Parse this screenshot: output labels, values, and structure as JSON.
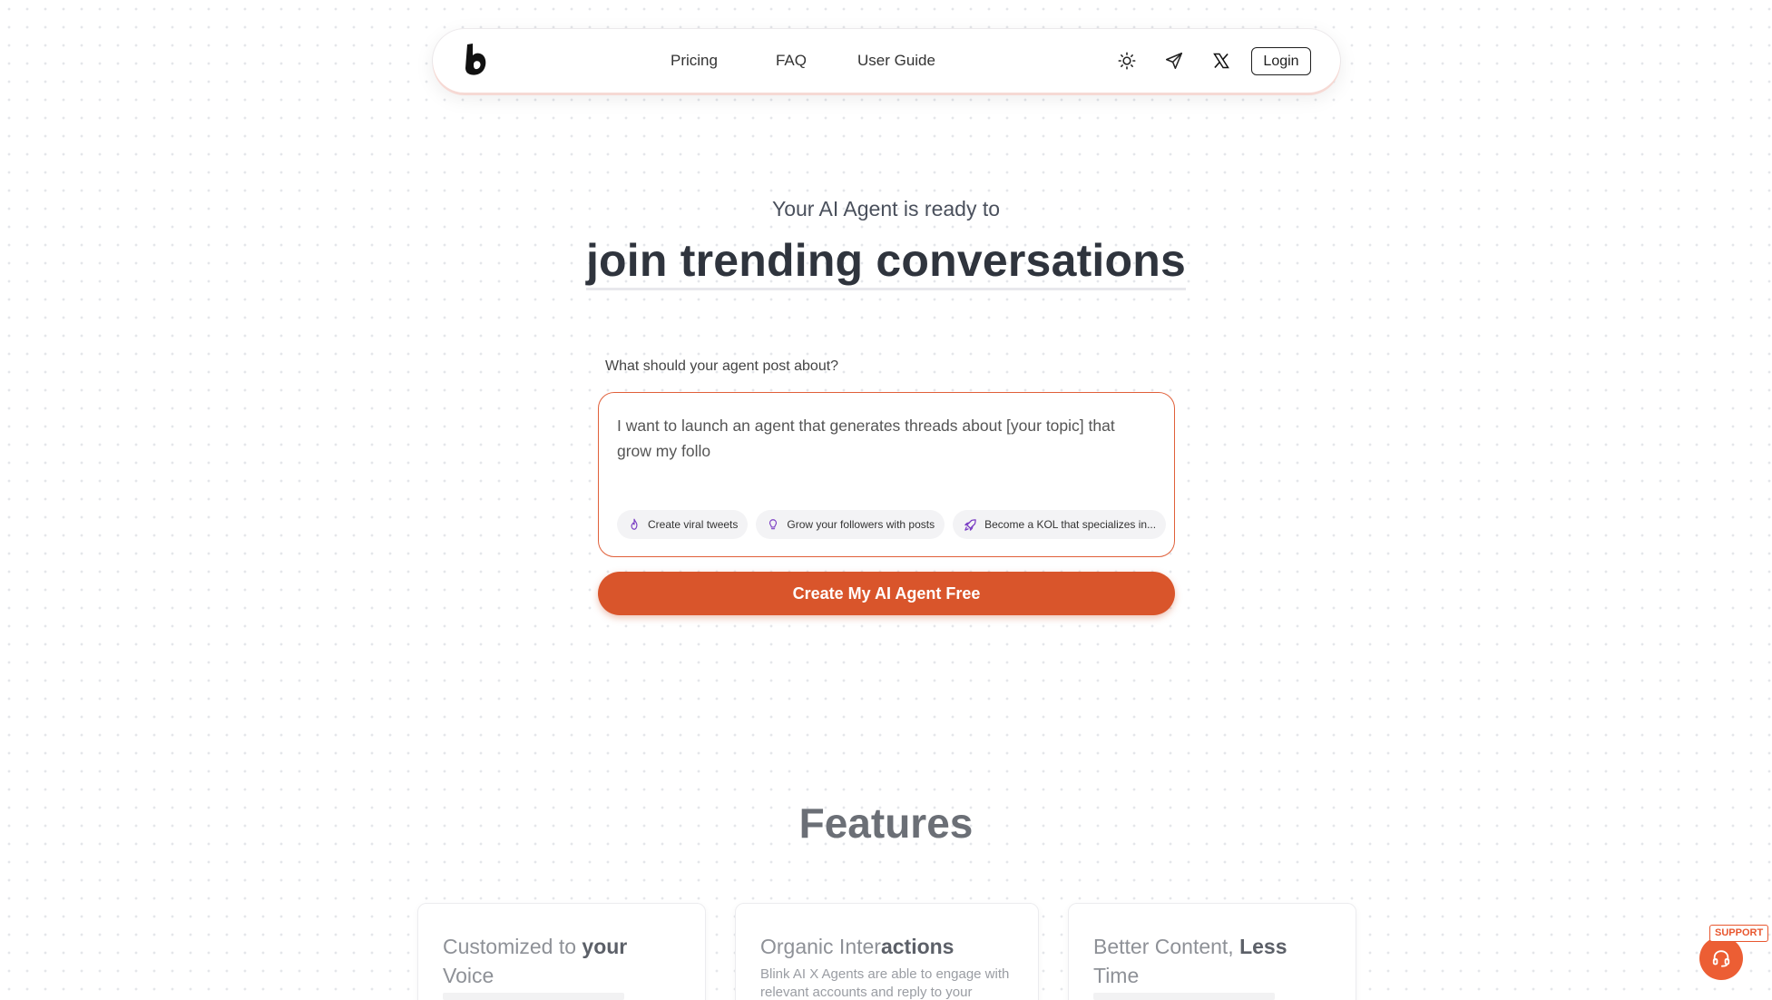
{
  "nav": {
    "logo_icon": "b-logo-icon",
    "links": [
      {
        "label": "Pricing"
      },
      {
        "label": "FAQ"
      },
      {
        "label": "User Guide"
      }
    ],
    "icons": [
      "sun-icon",
      "paper-plane-icon",
      "x-logo-icon"
    ],
    "login_label": "Login"
  },
  "hero": {
    "subtitle": "Your AI Agent is ready to",
    "title": "join trending conversations"
  },
  "prompt": {
    "label": "What should your agent post about?",
    "value": "I want to launch an agent that generates threads about [your topic] that grow my follo",
    "chips": [
      {
        "label": "Create viral tweets",
        "icon": "flame-icon"
      },
      {
        "label": "Grow your followers with posts",
        "icon": "lightbulb-icon"
      },
      {
        "label": "Become a KOL that specializes in...",
        "icon": "rocket-icon"
      }
    ]
  },
  "cta": {
    "label": "Create My AI Agent Free"
  },
  "features": {
    "title": "Features",
    "cards": [
      {
        "title_plain": "Customized to ",
        "title_bold": "your",
        "title_line2": "Voice",
        "desc_line1": "",
        "desc_line2": ""
      },
      {
        "title_plain": "Organic Inter",
        "title_bold": "actions",
        "title_line2": "",
        "desc_line1": "Blink AI X Agents are able to engage with",
        "desc_line2": "relevant accounts and reply to your"
      },
      {
        "title_plain": "Better Content, ",
        "title_bold": "Less",
        "title_line2": "Time",
        "desc_line1": "",
        "desc_line2": ""
      }
    ]
  },
  "support": {
    "label": "SUPPORT",
    "icon": "headset-icon"
  },
  "colors": {
    "accent": "#d9552b",
    "border_accent": "#e0603a",
    "text": "#2f343d"
  }
}
